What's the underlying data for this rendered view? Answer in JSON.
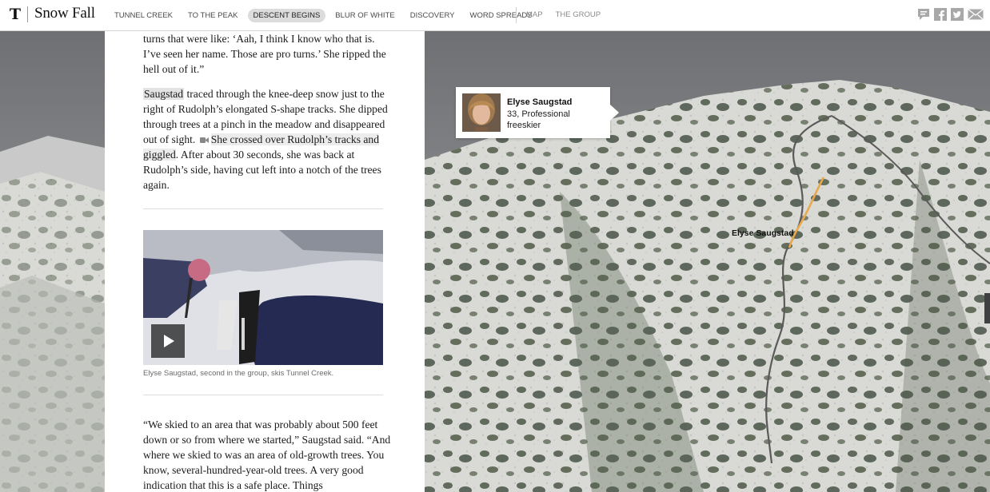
{
  "brand": {
    "logo": "T",
    "title": "Snow Fall"
  },
  "nav": {
    "chapters": [
      {
        "label": "TUNNEL CREEK",
        "active": false
      },
      {
        "label": "TO THE PEAK",
        "active": false
      },
      {
        "label": "DESCENT BEGINS",
        "active": true
      },
      {
        "label": "BLUR OF WHITE",
        "active": false
      },
      {
        "label": "DISCOVERY",
        "active": false
      },
      {
        "label": "WORD SPREADS",
        "active": false
      }
    ],
    "aux": [
      "MAP",
      "THE GROUP"
    ],
    "share_icons": [
      "comments-icon",
      "facebook-icon",
      "twitter-icon",
      "email-icon"
    ]
  },
  "article": {
    "p1": "turns that were like: ‘Aah, I think I know who that is. I’ve seen her name. Those are pro turns.’ She ripped the hell out of it.”",
    "p2_name": "Saugstad",
    "p2_a": " traced through the knee-deep snow just to the right of Rudolph’s elongated S-shape tracks. She dipped through trees at a pinch in the meadow and disappeared out of sight.",
    "p2_link": "She crossed over Rudolph’s tracks and giggled",
    "p2_b": ". After about 30 seconds, she was back at Rudolph’s side, having cut left into a notch of the trees again.",
    "video_caption": "Elyse Saugstad, second in the group, skis Tunnel Creek.",
    "p3": "“We skied to an area that was probably about 500 feet down or so from where we started,” Saugstad said. “And where we skied to was an area of old-growth trees. You know, several-hundred-year-old trees. A very good indication that this is a safe place. Things"
  },
  "callout": {
    "name": "Elyse Saugstad",
    "desc": "33, Professional freeskier"
  },
  "map": {
    "skier_label": "Elyse Saugstad",
    "track_color": "#e9a84a",
    "route_color": "#5a5a5a"
  },
  "colors": {
    "bar": "#ffffff",
    "active_chapter": "#dcdcdc",
    "highlight": "#e3e3e3"
  }
}
